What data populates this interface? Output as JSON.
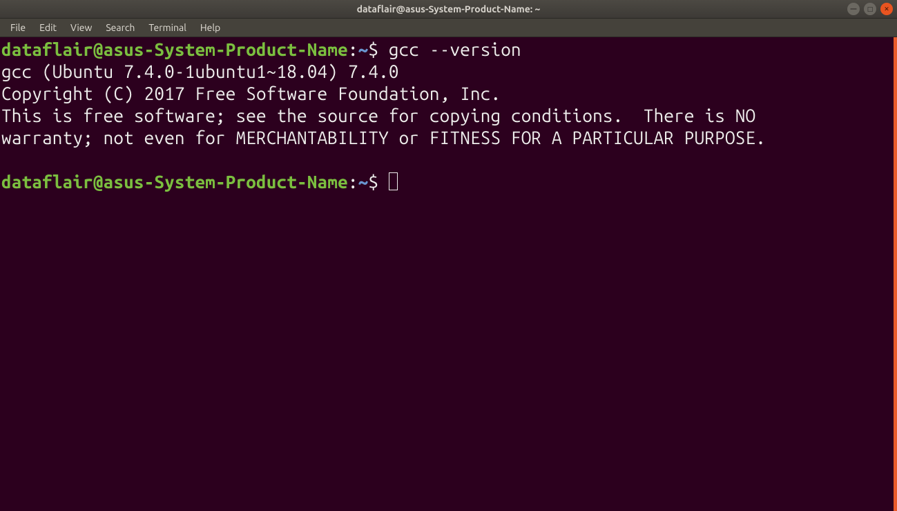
{
  "window": {
    "title": "dataflair@asus-System-Product-Name: ~"
  },
  "menu": {
    "file": "File",
    "edit": "Edit",
    "view": "View",
    "search": "Search",
    "terminal": "Terminal",
    "help": "Help"
  },
  "window_controls": {
    "min": "—",
    "max": "□",
    "close": "✕"
  },
  "terminal": {
    "prompt_user_host": "dataflair@asus-System-Product-Name",
    "prompt_sep": ":",
    "prompt_path": "~",
    "prompt_symbol": "$ ",
    "command1": "gcc --version",
    "output_line1": "gcc (Ubuntu 7.4.0-1ubuntu1~18.04) 7.4.0",
    "output_line2": "Copyright (C) 2017 Free Software Foundation, Inc.",
    "output_line3": "This is free software; see the source for copying conditions.  There is NO",
    "output_line4": "warranty; not even for MERCHANTABILITY or FITNESS FOR A PARTICULAR PURPOSE.",
    "blank": ""
  }
}
